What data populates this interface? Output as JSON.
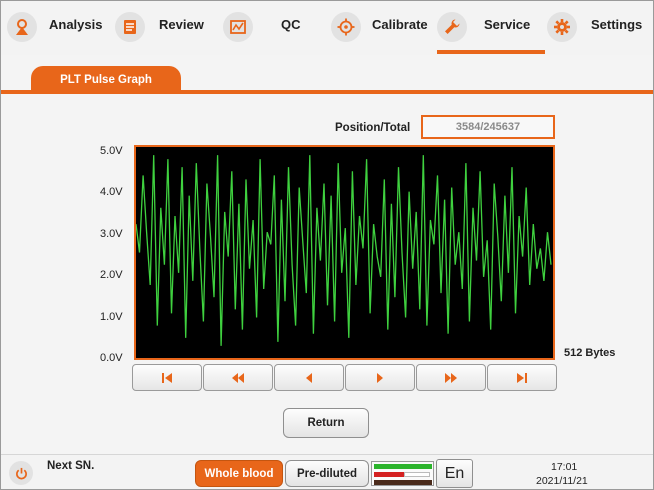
{
  "nav": {
    "items": [
      {
        "label": "Analysis",
        "icon": "analysis-icon"
      },
      {
        "label": "Review",
        "icon": "review-icon"
      },
      {
        "label": "QC",
        "icon": "qc-icon"
      },
      {
        "label": "Calibrate",
        "icon": "calibrate-icon"
      },
      {
        "label": "Service",
        "icon": "service-icon",
        "active": true
      },
      {
        "label": "Settings",
        "icon": "settings-icon"
      }
    ]
  },
  "tab": {
    "label": "PLT Pulse Graph"
  },
  "position": {
    "label": "Position/Total",
    "value": "3584/245637"
  },
  "graph": {
    "y_ticks": [
      "5.0V",
      "4.0V",
      "3.0V",
      "2.0V",
      "1.0V",
      "0.0V"
    ],
    "size_label": "512 Bytes"
  },
  "chart_data": {
    "type": "line",
    "ylim": [
      0,
      5
    ],
    "series": [
      {
        "values": [
          3.2,
          2.5,
          4.4,
          3.0,
          1.7,
          4.9,
          0.7,
          3.6,
          2.2,
          4.8,
          1.0,
          3.4,
          2.0,
          4.6,
          0.4,
          3.9,
          1.8,
          4.7,
          2.6,
          0.8,
          4.2,
          2.9,
          1.4,
          4.9,
          0.2,
          3.5,
          2.4,
          4.5,
          1.1,
          3.7,
          0.6,
          4.3,
          2.1,
          3.3,
          0.9,
          4.8,
          1.6,
          3.0,
          2.7,
          4.4,
          0.3,
          3.8,
          1.3,
          4.6,
          2.2,
          0.7,
          4.1,
          2.8,
          1.5,
          4.9,
          0.5,
          3.6,
          2.3,
          4.2,
          1.2,
          3.9,
          0.8,
          4.7,
          2.0,
          3.1,
          0.4,
          4.5,
          1.7,
          3.4,
          2.6,
          4.8,
          1.0,
          3.2,
          2.4,
          1.9,
          4.3,
          0.6,
          3.7,
          1.4,
          4.6,
          2.5,
          0.9,
          4.0,
          2.1,
          3.5,
          1.1,
          4.9,
          0.7,
          3.3,
          2.7,
          4.4,
          1.5,
          3.8,
          0.5,
          4.1,
          2.2,
          3.0,
          1.6,
          4.7,
          0.8,
          3.6,
          2.3,
          4.5,
          1.9,
          2.8,
          0.6,
          4.2,
          2.9,
          1.3,
          3.9,
          2.0,
          4.6,
          1.0,
          3.4,
          2.4,
          4.1,
          1.7,
          3.2,
          2.1,
          2.6,
          1.8,
          3.0,
          2.2
        ]
      }
    ]
  },
  "controls": {
    "first_label": "first-page",
    "return_label": "Return"
  },
  "footer": {
    "next_sn_label": "Next SN.",
    "whole_blood_label": "Whole blood",
    "prediluted_label": "Pre-diluted",
    "language_label": "En",
    "time": "17:01",
    "date": "2021/11/21"
  },
  "colors": {
    "accent": "#e8661a",
    "trace": "#3fd13f",
    "plot_bg": "#000000"
  }
}
